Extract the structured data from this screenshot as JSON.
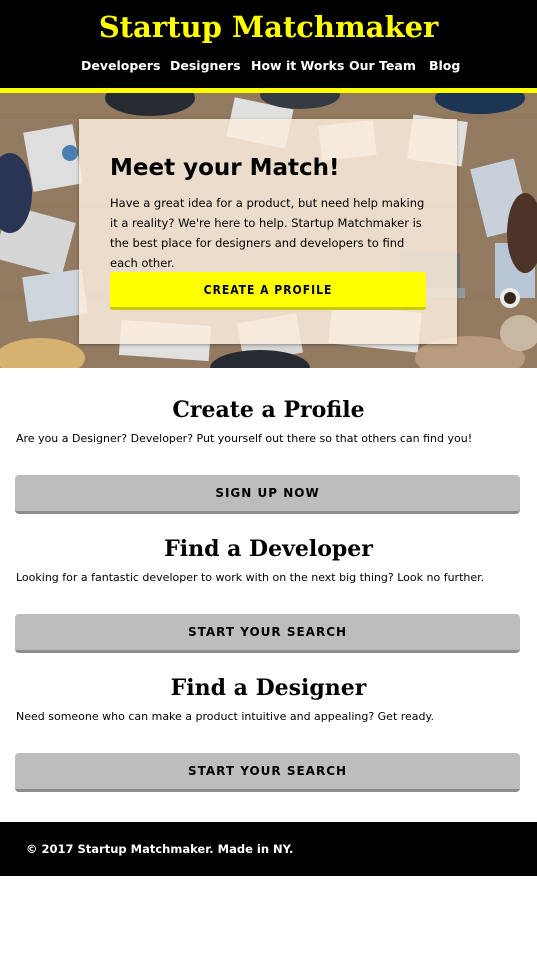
{
  "header": {
    "brand": "Startup Matchmaker",
    "nav": [
      "Developers",
      "Designers",
      "How it Works",
      "Our Team",
      "Blog"
    ]
  },
  "hero": {
    "title": "Meet your Match!",
    "text": "Have a great idea for a product, but need help making it a reality? We're here to help. Startup Matchmaker is the best place for designers and developers to find each other.",
    "cta_label": "CREATE A PROFILE"
  },
  "sections": [
    {
      "title": "Create a Profile",
      "text": "Are you a Designer? Developer? Put yourself out there so that others can find you!",
      "button_label": "SIGN UP NOW"
    },
    {
      "title": "Find a Developer",
      "text": "Looking for a fantastic developer to work with on the next big thing? Look no further.",
      "button_label": "START YOUR SEARCH"
    },
    {
      "title": "Find a Designer",
      "text": "Need someone who can make a product intuitive and appealing? Get ready.",
      "button_label": "START YOUR SEARCH"
    }
  ],
  "footer": {
    "text": "© 2017 Startup Matchmaker. Made in NY."
  },
  "colors": {
    "accent": "#ffff00",
    "header_bg": "#000000",
    "button_gray": "#bdbdbd"
  }
}
